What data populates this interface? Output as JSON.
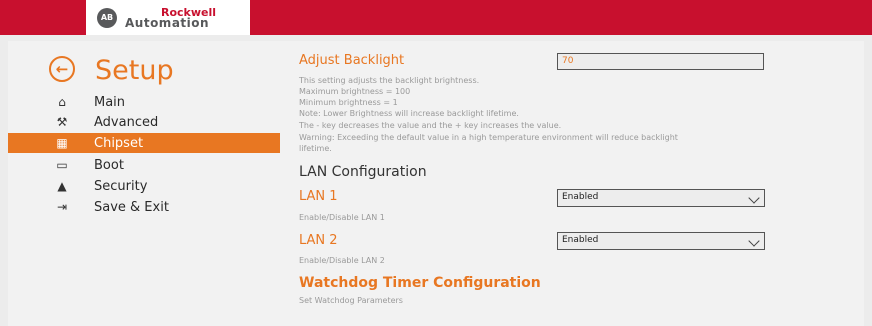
{
  "logo": {
    "badge": "AB",
    "line1": "Rockwell",
    "line2": "Automation"
  },
  "sidebar": {
    "title": "Setup",
    "items": [
      {
        "label": "Main",
        "icon": "home-icon",
        "glyph": "⌂"
      },
      {
        "label": "Advanced",
        "icon": "wrench-icon",
        "glyph": "⚒"
      },
      {
        "label": "Chipset",
        "icon": "chip-icon",
        "glyph": "▦",
        "active": true
      },
      {
        "label": "Boot",
        "icon": "drive-icon",
        "glyph": "▭"
      },
      {
        "label": "Security",
        "icon": "lock-icon",
        "glyph": "▲"
      },
      {
        "label": "Save & Exit",
        "icon": "exit-icon",
        "glyph": "⇥"
      }
    ]
  },
  "backlight": {
    "title": "Adjust Backlight",
    "value": "70",
    "description": [
      "This setting adjusts the backlight brightness.",
      "Maximum brightness = 100",
      "Minimum brightness = 1",
      "Note: Lower Brightness will increase backlight lifetime.",
      "The - key decreases the value and the + key increases the value.",
      "Warning: Exceeding the default value in a high temperature environment will reduce backlight",
      "lifetime."
    ]
  },
  "lan": {
    "title": "LAN Configuration",
    "lan1": {
      "label": "LAN 1",
      "value": "Enabled",
      "description": "Enable/Disable LAN 1"
    },
    "lan2": {
      "label": "LAN 2",
      "value": "Enabled",
      "description": "Enable/Disable LAN 2"
    }
  },
  "watchdog": {
    "title": "Watchdog Timer Configuration",
    "description": "Set Watchdog Parameters"
  },
  "colors": {
    "brand_red": "#c8102e",
    "accent_orange": "#e87722",
    "panel": "#f2f2f2"
  }
}
